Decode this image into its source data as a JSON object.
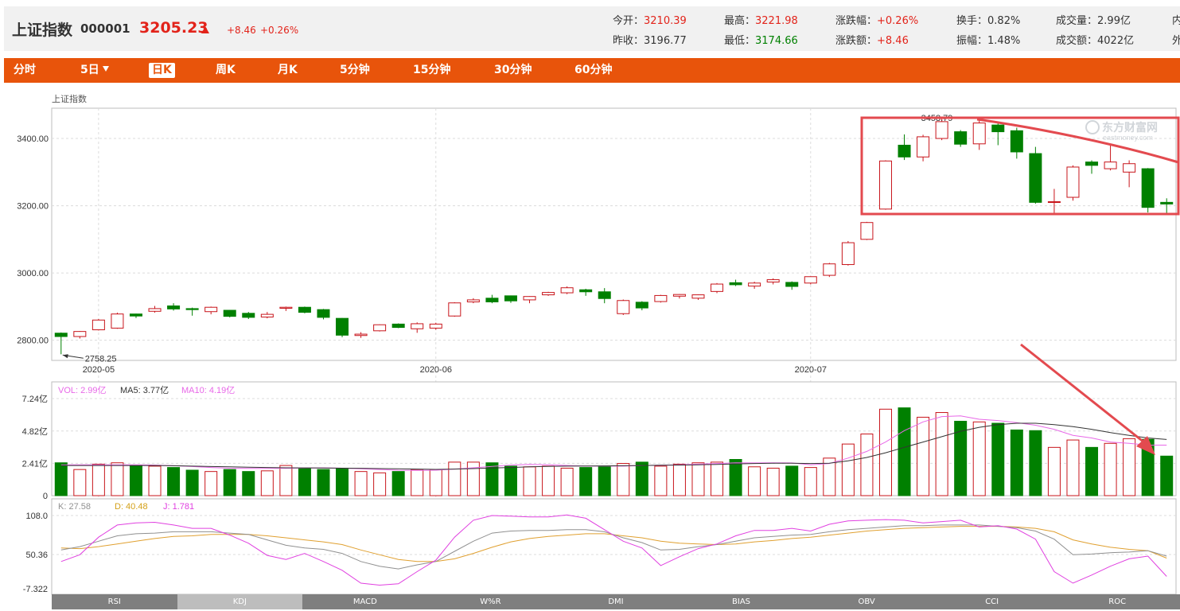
{
  "header": {
    "name": "上证指数",
    "code": "000001",
    "price": "3205.23",
    "change": "+8.46",
    "change_pct": "+0.26%",
    "stats": [
      {
        "label": "今开：",
        "value": "3210.39",
        "tone": "up"
      },
      {
        "label": "最高：",
        "value": "3221.98",
        "tone": "up"
      },
      {
        "label": "涨跌幅：",
        "value": "+0.26%",
        "tone": "up"
      },
      {
        "label": "换手：",
        "value": "0.82%",
        "tone": ""
      },
      {
        "label": "成交量：",
        "value": "2.99亿",
        "tone": ""
      },
      {
        "label": "昨收：",
        "value": "3196.77",
        "tone": ""
      },
      {
        "label": "最低：",
        "value": "3174.66",
        "tone": "dn"
      },
      {
        "label": "涨跌额：",
        "value": "+8.46",
        "tone": "up"
      },
      {
        "label": "振幅：",
        "value": "1.48%",
        "tone": ""
      },
      {
        "label": "成交额：",
        "value": "4022亿",
        "tone": ""
      }
    ],
    "cut_labels": [
      "内",
      "外"
    ]
  },
  "tabs": [
    "分时",
    "5日",
    "日K",
    "周K",
    "月K",
    "5分钟",
    "15分钟",
    "30分钟",
    "60分钟"
  ],
  "active_tab": "日K",
  "bottom_tabs": [
    "RSI",
    "KDJ",
    "MACD",
    "W%R",
    "DMI",
    "BIAS",
    "OBV",
    "CCI",
    "ROC"
  ],
  "active_bottom_tab": "KDJ",
  "colors": {
    "up": "#c8151b",
    "down": "#008000",
    "accent": "#e8540b",
    "annotation": "#e34a4f"
  },
  "watermark": {
    "cn": "东方财富网",
    "en": "eastmoney.com"
  },
  "chart_data": {
    "type": "candlestick",
    "title": "上证指数",
    "x": [
      "2020-04-29",
      "2020-04-30",
      "2020-05-06",
      "2020-05-07",
      "2020-05-08",
      "2020-05-11",
      "2020-05-12",
      "2020-05-13",
      "2020-05-14",
      "2020-05-15",
      "2020-05-18",
      "2020-05-19",
      "2020-05-20",
      "2020-05-21",
      "2020-05-22",
      "2020-05-25",
      "2020-05-26",
      "2020-05-27",
      "2020-05-28",
      "2020-05-29",
      "2020-06-01",
      "2020-06-02",
      "2020-06-03",
      "2020-06-04",
      "2020-06-05",
      "2020-06-08",
      "2020-06-09",
      "2020-06-10",
      "2020-06-11",
      "2020-06-12",
      "2020-06-15",
      "2020-06-16",
      "2020-06-17",
      "2020-06-18",
      "2020-06-19",
      "2020-06-22",
      "2020-06-23",
      "2020-06-24",
      "2020-06-29",
      "2020-06-30",
      "2020-07-01",
      "2020-07-02",
      "2020-07-03",
      "2020-07-06",
      "2020-07-07",
      "2020-07-08",
      "2020-07-09",
      "2020-07-10",
      "2020-07-13",
      "2020-07-14",
      "2020-07-15",
      "2020-07-16",
      "2020-07-17",
      "2020-07-20",
      "2020-07-21",
      "2020-07-22",
      "2020-07-23",
      "2020-07-24",
      "2020-07-27",
      "2020-07-28"
    ],
    "x_tick_labels": [
      "2020-05",
      "2020-06",
      "2020-07"
    ],
    "x_tick_dates": [
      "2020-05-06",
      "2020-06-01",
      "2020-07-01"
    ],
    "ohlc": [
      {
        "o": 2821,
        "h": 2823,
        "l": 2758.25,
        "c": 2811
      },
      {
        "o": 2811,
        "h": 2827,
        "l": 2805,
        "c": 2826
      },
      {
        "o": 2831,
        "h": 2863,
        "l": 2829,
        "c": 2860
      },
      {
        "o": 2836,
        "h": 2882,
        "l": 2834,
        "c": 2878
      },
      {
        "o": 2878,
        "h": 2879,
        "l": 2866,
        "c": 2872
      },
      {
        "o": 2886,
        "h": 2902,
        "l": 2882,
        "c": 2894
      },
      {
        "o": 2902,
        "h": 2910,
        "l": 2888,
        "c": 2893
      },
      {
        "o": 2894,
        "h": 2897,
        "l": 2873,
        "c": 2891
      },
      {
        "o": 2885,
        "h": 2900,
        "l": 2877,
        "c": 2898
      },
      {
        "o": 2889,
        "h": 2890,
        "l": 2868,
        "c": 2871
      },
      {
        "o": 2880,
        "h": 2884,
        "l": 2863,
        "c": 2868
      },
      {
        "o": 2869,
        "h": 2884,
        "l": 2865,
        "c": 2877
      },
      {
        "o": 2895,
        "h": 2900,
        "l": 2887,
        "c": 2898
      },
      {
        "o": 2898,
        "h": 2900,
        "l": 2880,
        "c": 2883
      },
      {
        "o": 2891,
        "h": 2893,
        "l": 2862,
        "c": 2868
      },
      {
        "o": 2865,
        "h": 2866,
        "l": 2809,
        "c": 2815
      },
      {
        "o": 2814,
        "h": 2824,
        "l": 2807,
        "c": 2818
      },
      {
        "o": 2828,
        "h": 2847,
        "l": 2826,
        "c": 2846
      },
      {
        "o": 2848,
        "h": 2850,
        "l": 2836,
        "c": 2838
      },
      {
        "o": 2834,
        "h": 2853,
        "l": 2822,
        "c": 2849
      },
      {
        "o": 2836,
        "h": 2852,
        "l": 2831,
        "c": 2848
      },
      {
        "o": 2872,
        "h": 2913,
        "l": 2870,
        "c": 2911
      },
      {
        "o": 2914,
        "h": 2925,
        "l": 2910,
        "c": 2920
      },
      {
        "o": 2925,
        "h": 2935,
        "l": 2910,
        "c": 2914
      },
      {
        "o": 2932,
        "h": 2933,
        "l": 2911,
        "c": 2917
      },
      {
        "o": 2920,
        "h": 2931,
        "l": 2910,
        "c": 2930
      },
      {
        "o": 2935,
        "h": 2944,
        "l": 2932,
        "c": 2942
      },
      {
        "o": 2941,
        "h": 2960,
        "l": 2937,
        "c": 2956
      },
      {
        "o": 2950,
        "h": 2953,
        "l": 2932,
        "c": 2944
      },
      {
        "o": 2944,
        "h": 2955,
        "l": 2910,
        "c": 2924
      },
      {
        "o": 2879,
        "h": 2921,
        "l": 2875,
        "c": 2918
      },
      {
        "o": 2913,
        "h": 2916,
        "l": 2889,
        "c": 2896
      },
      {
        "o": 2915,
        "h": 2935,
        "l": 2912,
        "c": 2933
      },
      {
        "o": 2931,
        "h": 2937,
        "l": 2924,
        "c": 2936
      },
      {
        "o": 2925,
        "h": 2936,
        "l": 2920,
        "c": 2935
      },
      {
        "o": 2945,
        "h": 2970,
        "l": 2940,
        "c": 2967
      },
      {
        "o": 2971,
        "h": 2980,
        "l": 2961,
        "c": 2965
      },
      {
        "o": 2961,
        "h": 2974,
        "l": 2953,
        "c": 2970
      },
      {
        "o": 2973,
        "h": 2984,
        "l": 2966,
        "c": 2980
      },
      {
        "o": 2972,
        "h": 2975,
        "l": 2950,
        "c": 2960
      },
      {
        "o": 2970,
        "h": 2990,
        "l": 2966,
        "c": 2989
      },
      {
        "o": 2993,
        "h": 3030,
        "l": 2988,
        "c": 3027
      },
      {
        "o": 3025,
        "h": 3095,
        "l": 3022,
        "c": 3090
      },
      {
        "o": 3100,
        "h": 3152,
        "l": 3098,
        "c": 3150
      },
      {
        "o": 3190,
        "h": 3335,
        "l": 3188,
        "c": 3333
      },
      {
        "o": 3380,
        "h": 3412,
        "l": 3336,
        "c": 3345
      },
      {
        "o": 3345,
        "h": 3411,
        "l": 3332,
        "c": 3405
      },
      {
        "o": 3400,
        "h": 3458.79,
        "l": 3395,
        "c": 3450
      },
      {
        "o": 3420,
        "h": 3425,
        "l": 3375,
        "c": 3383
      },
      {
        "o": 3384,
        "h": 3455,
        "l": 3366,
        "c": 3446
      },
      {
        "o": 3440,
        "h": 3448,
        "l": 3380,
        "c": 3420
      },
      {
        "o": 3423,
        "h": 3432,
        "l": 3340,
        "c": 3360
      },
      {
        "o": 3355,
        "h": 3375,
        "l": 3206,
        "c": 3210
      },
      {
        "o": 3210,
        "h": 3250,
        "l": 3178,
        "c": 3212
      },
      {
        "o": 3225,
        "h": 3320,
        "l": 3215,
        "c": 3315
      },
      {
        "o": 3330,
        "h": 3335,
        "l": 3295,
        "c": 3320
      },
      {
        "o": 3310,
        "h": 3380,
        "l": 3305,
        "c": 3330
      },
      {
        "o": 3300,
        "h": 3335,
        "l": 3255,
        "c": 3325
      },
      {
        "o": 3310,
        "h": 3312,
        "l": 3180,
        "c": 3195
      },
      {
        "o": 3210,
        "h": 3222,
        "l": 3175,
        "c": 3205
      }
    ],
    "ylim": [
      2740,
      3490
    ],
    "y_ticks": [
      2800,
      3000,
      3200,
      3400
    ],
    "y_tick_labels": [
      "2800.00",
      "3000.00",
      "3200.00",
      "3400.00"
    ],
    "annotations": {
      "max_label": "3458.79",
      "min_label": "2758.25",
      "max_index": 47,
      "min_index": 0
    },
    "volume": {
      "label_vol": "VOL: 2.99亿",
      "label_ma5": "MA5: 3.77亿",
      "label_ma10": "MA10: 4.19亿",
      "values": [
        2.45,
        1.95,
        2.35,
        2.45,
        2.2,
        2.2,
        2.1,
        1.9,
        1.8,
        1.95,
        1.8,
        1.85,
        2.25,
        2.05,
        1.95,
        2.05,
        1.8,
        1.7,
        1.8,
        1.95,
        1.95,
        2.5,
        2.5,
        2.45,
        2.2,
        2.15,
        2.2,
        2.05,
        2.1,
        2.2,
        2.4,
        2.5,
        2.2,
        2.35,
        2.45,
        2.5,
        2.7,
        2.15,
        2.05,
        2.2,
        2.1,
        2.8,
        3.85,
        4.6,
        6.45,
        6.55,
        5.85,
        6.2,
        5.55,
        5.5,
        5.4,
        4.9,
        4.85,
        3.6,
        4.15,
        3.6,
        3.9,
        4.25,
        4.2,
        2.95
      ],
      "ma5": [
        2.3,
        2.3,
        2.3,
        2.3,
        2.3,
        2.28,
        2.23,
        2.17,
        2.1,
        2.05,
        2.03,
        2.03,
        2.04,
        2.06,
        2.08,
        2.05,
        2.0,
        1.95,
        1.9,
        1.88,
        1.9,
        1.98,
        2.08,
        2.18,
        2.28,
        2.33,
        2.3,
        2.25,
        2.2,
        2.2,
        2.2,
        2.25,
        2.27,
        2.3,
        2.35,
        2.4,
        2.45,
        2.44,
        2.45,
        2.44,
        2.3,
        2.4,
        2.8,
        3.3,
        4.0,
        4.85,
        5.5,
        5.9,
        5.95,
        5.7,
        5.6,
        5.45,
        5.25,
        4.95,
        4.5,
        4.3,
        4.0,
        3.9,
        3.77,
        3.77
      ],
      "ma10": [
        2.25,
        2.25,
        2.25,
        2.25,
        2.25,
        2.25,
        2.23,
        2.2,
        2.17,
        2.15,
        2.12,
        2.1,
        2.08,
        2.07,
        2.06,
        2.05,
        2.04,
        2.02,
        2.0,
        1.98,
        1.96,
        1.98,
        2.02,
        2.06,
        2.1,
        2.15,
        2.18,
        2.2,
        2.21,
        2.22,
        2.23,
        2.25,
        2.27,
        2.28,
        2.3,
        2.33,
        2.37,
        2.4,
        2.42,
        2.42,
        2.4,
        2.42,
        2.6,
        2.85,
        3.2,
        3.6,
        4.0,
        4.4,
        4.8,
        5.1,
        5.3,
        5.4,
        5.4,
        5.3,
        5.15,
        4.95,
        4.7,
        4.5,
        4.3,
        4.19
      ],
      "ylim": [
        0,
        7.24
      ],
      "y_ticks": [
        0,
        2.41,
        4.82,
        7.24
      ],
      "y_tick_labels": [
        "0",
        "2.41亿",
        "4.82亿",
        "7.24亿"
      ]
    },
    "kdj": {
      "label_k": "K: 27.58",
      "label_d": "D: 40.48",
      "label_j": "J: 1.781",
      "k": [
        57,
        62,
        70,
        78,
        81,
        82,
        84,
        84,
        84,
        82,
        80,
        72,
        64,
        60,
        58,
        52,
        40,
        33,
        29,
        35,
        40,
        55,
        70,
        82,
        85,
        86,
        86,
        87,
        87,
        84,
        75,
        68,
        57,
        58,
        62,
        65,
        70,
        75,
        77,
        79,
        80,
        84,
        87,
        89,
        91,
        93,
        93,
        94,
        94,
        94,
        92,
        90,
        85,
        73,
        50,
        51,
        53,
        54,
        56,
        48
      ],
      "d": [
        60,
        59,
        62,
        66,
        70,
        74,
        77,
        78,
        80,
        80,
        80,
        78,
        75,
        72,
        69,
        65,
        57,
        50,
        43,
        40,
        40,
        44,
        52,
        61,
        69,
        74,
        77,
        79,
        81,
        81,
        78,
        75,
        70,
        67,
        66,
        65,
        66,
        69,
        71,
        74,
        76,
        79,
        82,
        85,
        87,
        89,
        90,
        91,
        92,
        92,
        92,
        91,
        89,
        84,
        72,
        66,
        61,
        58,
        56,
        45
      ],
      "j": [
        40,
        50,
        76,
        94,
        97,
        98,
        94,
        89,
        89,
        79,
        67,
        49,
        43,
        52,
        40,
        27,
        8,
        5,
        7,
        25,
        42,
        76,
        101,
        108,
        107,
        106,
        106,
        109,
        104,
        87,
        70,
        60,
        34,
        47,
        59,
        66,
        78,
        86,
        86,
        89,
        85,
        95,
        100,
        101,
        102,
        101,
        97,
        99,
        101,
        91,
        93,
        88,
        73,
        25,
        8,
        20,
        33,
        44,
        48,
        18
      ],
      "ylim": [
        -7.322,
        108.0
      ],
      "y_tick_labels": [
        "108.0",
        "50.36",
        "-7.322"
      ]
    }
  }
}
